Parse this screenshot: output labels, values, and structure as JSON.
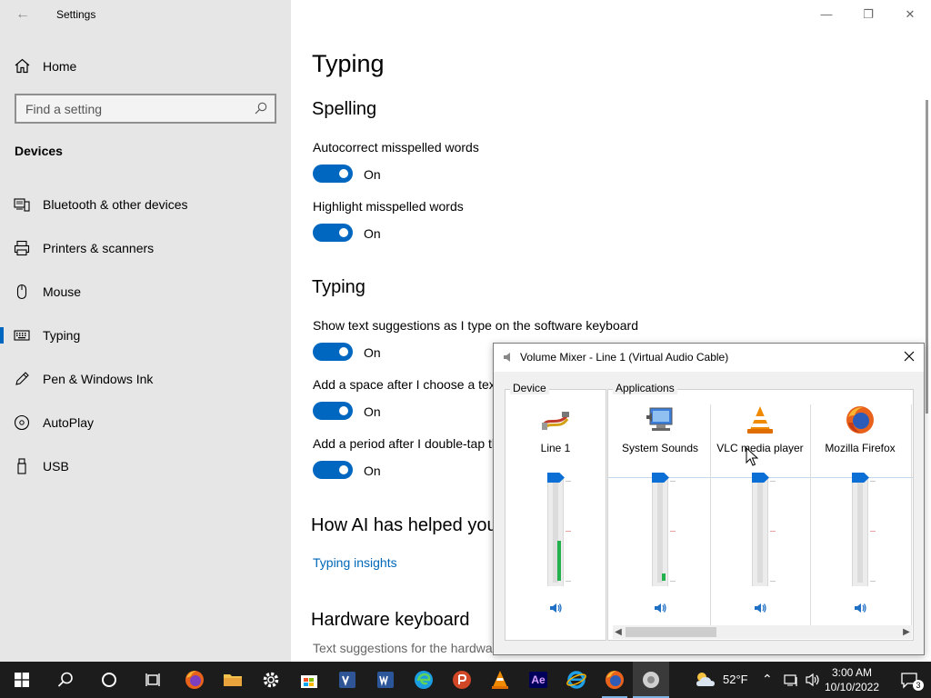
{
  "window": {
    "title": "Settings",
    "back_glyph": "←",
    "controls": {
      "minimize": "—",
      "maximize": "❐",
      "close": "✕"
    }
  },
  "sidebar": {
    "home_label": "Home",
    "search_placeholder": "Find a setting",
    "section_title": "Devices",
    "items": [
      {
        "label": "Bluetooth & other devices",
        "icon": "bluetooth-devices-icon"
      },
      {
        "label": "Printers & scanners",
        "icon": "printer-icon"
      },
      {
        "label": "Mouse",
        "icon": "mouse-icon"
      },
      {
        "label": "Typing",
        "icon": "keyboard-icon",
        "active": true
      },
      {
        "label": "Pen & Windows Ink",
        "icon": "pen-icon"
      },
      {
        "label": "AutoPlay",
        "icon": "autoplay-icon"
      },
      {
        "label": "USB",
        "icon": "usb-icon"
      }
    ]
  },
  "main": {
    "page_title": "Typing",
    "spelling": {
      "heading": "Spelling",
      "autocorrect_label": "Autocorrect misspelled words",
      "autocorrect_state": "On",
      "highlight_label": "Highlight misspelled words",
      "highlight_state": "On"
    },
    "typing": {
      "heading": "Typing",
      "suggestions_label": "Show text suggestions as I type on the software keyboard",
      "suggestions_state": "On",
      "space_label": "Add a space after I choose a text suggestion",
      "space_state": "On",
      "period_label": "Add a period after I double-tap the Spacebar",
      "period_state": "On"
    },
    "ai": {
      "heading": "How AI has helped you",
      "link": "Typing insights"
    },
    "hardware": {
      "heading": "Hardware keyboard",
      "text": "Text suggestions for the hardware keyboard"
    }
  },
  "mixer": {
    "title": "Volume Mixer - Line 1 (Virtual Audio Cable)",
    "device_group": "Device",
    "apps_group": "Applications",
    "channels": [
      {
        "label": "Line 1",
        "icon": "audio-cable-icon",
        "volume": 1.0,
        "meter": 0.4
      },
      {
        "label": "System Sounds",
        "icon": "system-sounds-icon",
        "volume": 1.0,
        "meter": 0.07
      },
      {
        "label": "VLC media player",
        "icon": "vlc-icon",
        "volume": 1.0,
        "meter": 0
      },
      {
        "label": "Mozilla Firefox",
        "icon": "firefox-icon",
        "volume": 1.0,
        "meter": 0
      }
    ]
  },
  "taskbar": {
    "weather_temp": "52°F",
    "time": "3:00 AM",
    "date": "10/10/2022",
    "notification_count": "3",
    "ae_label": "Ae"
  }
}
